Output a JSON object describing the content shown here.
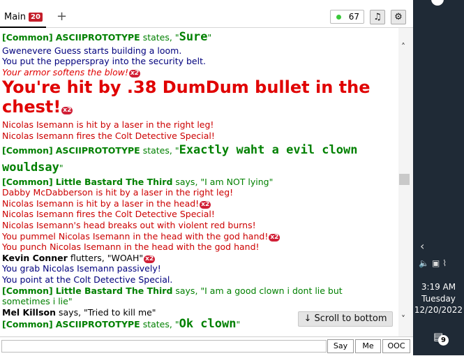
{
  "tabs": {
    "main_label": "Main",
    "main_badge": "20",
    "add_label": "+"
  },
  "toolbar": {
    "ping_value": "67",
    "ping_color": "#3ac83a",
    "music_icon": "♫",
    "settings_icon": "⚙"
  },
  "chat": {
    "l1_tag": "[Common]",
    "l1_name": "ASCIIPROTOTYPE",
    "l1_verb": " states, \"",
    "l1_msg": "Sure",
    "l1_end": "\"",
    "l2": "Gwenevere Guess starts building a loom.",
    "l3": "You put the pepperspray into the security belt.",
    "l4": "Your armor softens the blow!",
    "l4_x": "x2",
    "l5": "You're hit by .38 DumDum bullet in the chest!",
    "l5_x": "x2",
    "l6": "Nicolas Isemann is hit by a laser in the right leg!",
    "l7": "Nicolas Isemann fires the Colt Detective Special!",
    "l8_tag": "[Common]",
    "l8_name": "ASCIIPROTOTYPE",
    "l8_verb": " states, \"",
    "l8_msg": "Exactly waht a evil clown wouldsay",
    "l8_end": "\"",
    "l9_tag": "[Common]",
    "l9_name": "Little Bastard The Third",
    "l9_verb": " says, \"I am NOT lying\"",
    "l10": "Dabby McDabberson is hit by a laser in the right leg!",
    "l11": "Nicolas Isemann is hit by a laser in the head!",
    "l11_x": "x2",
    "l12": "Nicolas Isemann fires the Colt Detective Special!",
    "l13": "Nicolas Isemann's head breaks out with violent red burns!",
    "l14": "You pummel Nicolas Isemann in the head with the god hand!",
    "l14_x": "x2",
    "l15": "You punch Nicolas Isemann in the head with the god hand!",
    "l16_name": "Kevin Conner",
    "l16_rest": " flutters, \"WOAH\"",
    "l16_x": "x2",
    "l17": "You grab Nicolas Isemann passively!",
    "l18": "You point at the Colt Detective Special.",
    "l19_tag": "[Common]",
    "l19_name": "Little Bastard The Third",
    "l19_verb": " says, \"I am a good clown i dont lie but sometimes i lie\"",
    "l20_name": "Mel Killson",
    "l20_rest": " says, \"Tried to kill me\"",
    "l21_tag": "[Common]",
    "l21_name": "ASCIIPROTOTYPE",
    "l21_verb": " states, \"",
    "l21_msg": "Ok clown",
    "l21_end": "\""
  },
  "scroll_bottom_label": "↓ Scroll to bottom",
  "input": {
    "say": "Say",
    "me": "Me",
    "ooc": "OOC"
  },
  "taskbar": {
    "time": "3:19 AM",
    "day": "Tuesday",
    "date": "12/20/2022",
    "notif_count": "9"
  }
}
